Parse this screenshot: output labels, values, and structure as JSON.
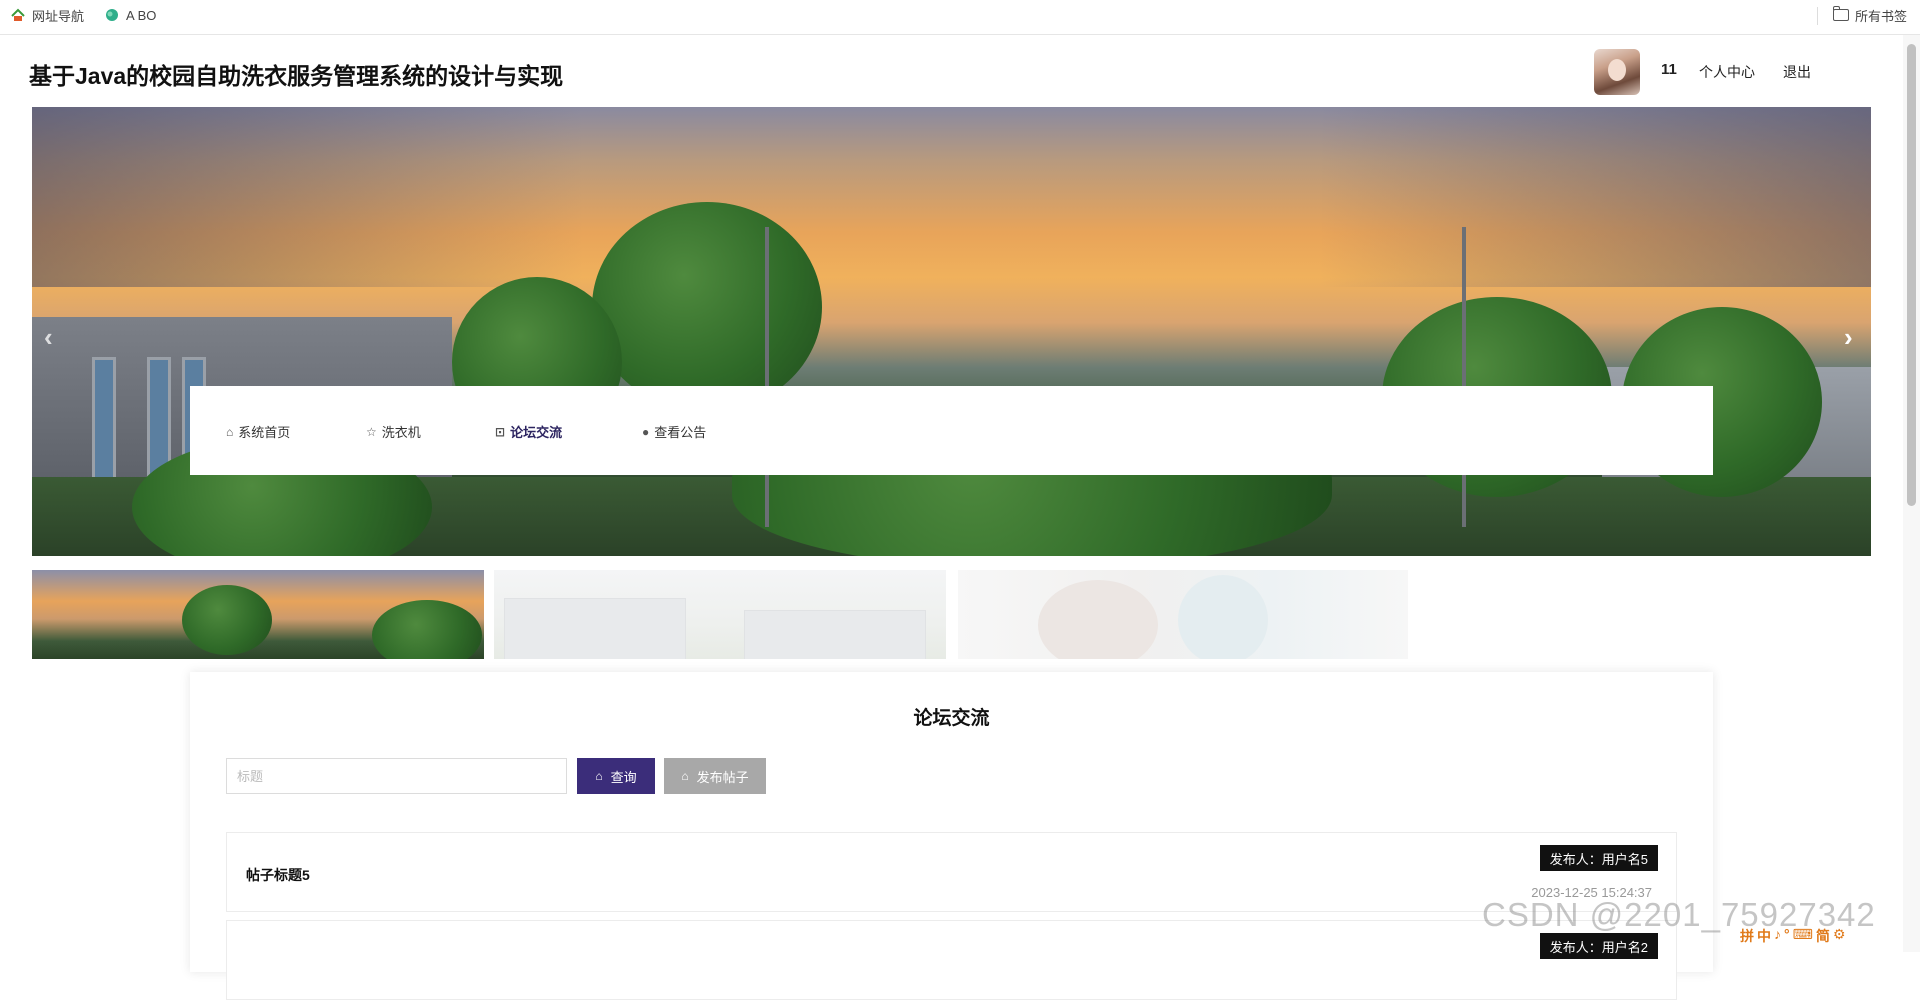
{
  "browser": {
    "bookmarks": [
      {
        "label": "网址导航",
        "icon": "nav-site-icon"
      },
      {
        "label": "A BO",
        "icon": "leaf-icon"
      }
    ],
    "all_bookmarks_label": "所有书签"
  },
  "header": {
    "title": "基于Java的校园自助洗衣服务管理系统的设计与实现",
    "user_name": "11",
    "user_center_label": "个人中心",
    "logout_label": "退出"
  },
  "banner": {
    "prev_arrow": "‹",
    "next_arrow": "›"
  },
  "nav": {
    "items": [
      {
        "label": "系统首页",
        "icon": "home-icon"
      },
      {
        "label": "洗衣机",
        "icon": "star-icon"
      },
      {
        "label": "论坛交流",
        "icon": "bag-icon",
        "active": true
      },
      {
        "label": "查看公告",
        "icon": "info-icon"
      }
    ]
  },
  "forum": {
    "title": "论坛交流",
    "search_placeholder": "标题",
    "search_value": "",
    "query_label": "查询",
    "post_label": "发布帖子",
    "posts": [
      {
        "title": "帖子标题5",
        "author": "发布人：用户名5",
        "time": "2023-12-25 15:24:37"
      },
      {
        "title": "",
        "author": "发布人：用户名2",
        "time": ""
      }
    ]
  },
  "watermark": "CSDN @2201_75927342",
  "ime": [
    "拼",
    "中",
    "♪",
    "°",
    "⌨",
    "简",
    "⚙"
  ],
  "colors": {
    "primary": "#3b2d7a",
    "secondary_button": "#a8a8a8",
    "author_badge": "#111111"
  }
}
